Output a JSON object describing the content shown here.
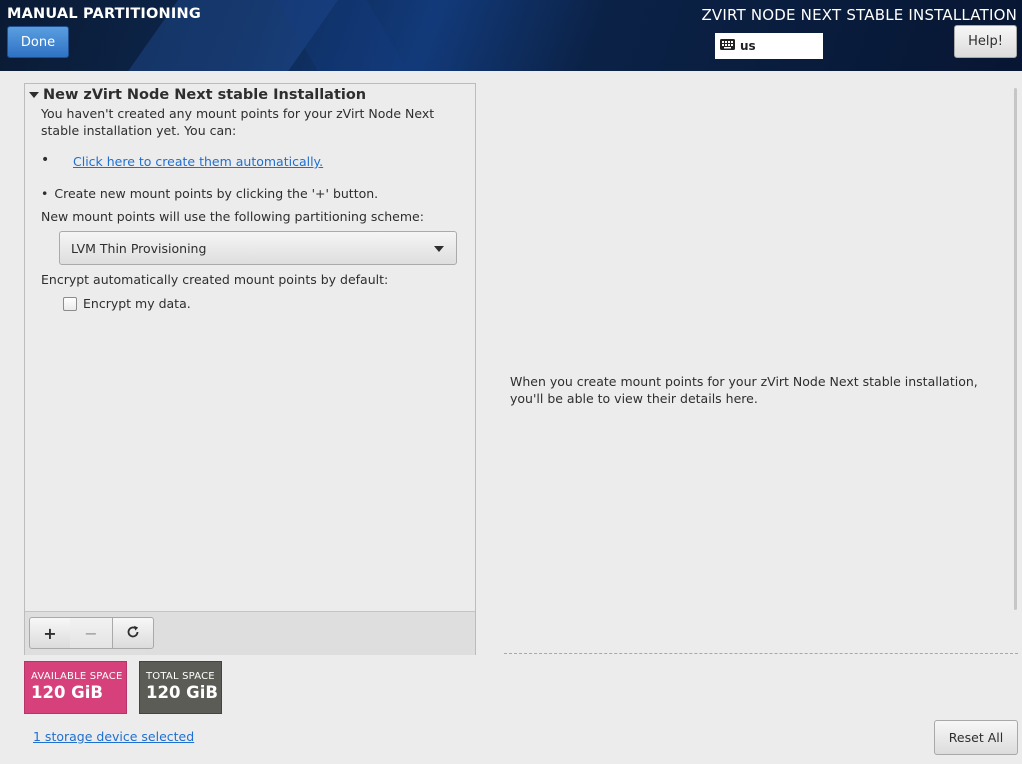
{
  "header": {
    "left_title": "MANUAL PARTITIONING",
    "right_title": "ZVIRT NODE NEXT STABLE INSTALLATION",
    "done_label": "Done",
    "keyboard_layout": "us",
    "help_label": "Help!"
  },
  "left_panel": {
    "expander_title": "New zVirt Node Next stable Installation",
    "description": "You haven't created any mount points for your zVirt Node Next stable installation yet.  You can:",
    "bullet_symbol": "•",
    "auto_link": "Click here to create them automatically.",
    "manual_text": "Create new mount points by clicking the '+' button.",
    "scheme_label": "New mount points will use the following partitioning scheme:",
    "scheme_selected": "LVM Thin Provisioning",
    "encrypt_label": "Encrypt automatically created mount points by default:",
    "encrypt_checkbox_label": "Encrypt my data.",
    "encrypt_checked": false,
    "toolbar": {
      "add_symbol": "+",
      "remove_symbol": "−",
      "refresh_icon": "refresh-icon"
    }
  },
  "space": {
    "available_label": "AVAILABLE SPACE",
    "available_value": "120 GiB",
    "total_label": "TOTAL SPACE",
    "total_value": "120 GiB",
    "available_color": "#d6417c",
    "total_color": "#5c5c56"
  },
  "storage_link": "1 storage device selected",
  "reset_label": "Reset All",
  "right_message": "When you create mount points for your zVirt Node Next stable installation, you'll be able to view their details here."
}
